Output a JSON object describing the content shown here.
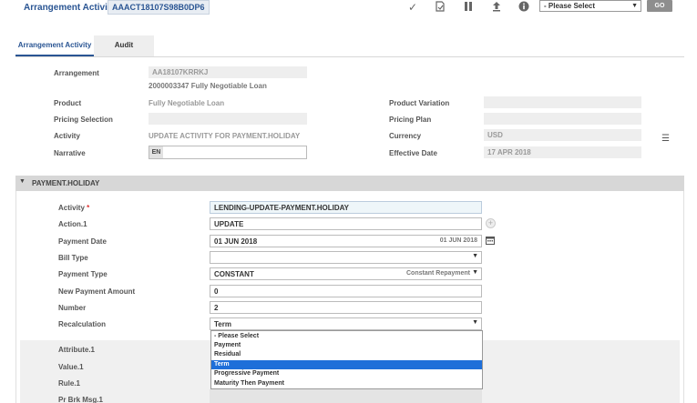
{
  "header": {
    "title": "Arrangement Activity",
    "arrangement_id": "AAACT18107S98B0DP6",
    "select_value": "- Please Select",
    "go_label": "GO"
  },
  "tabs": [
    {
      "label": "Arrangement Activity",
      "active": true
    },
    {
      "label": "Audit",
      "active": false
    }
  ],
  "top_form": {
    "arrangement_label": "Arrangement",
    "arrangement_value": "AA18107KRRKJ",
    "arrangement_sub": "2000003347 Fully Negotiable Loan",
    "product_label": "Product",
    "product_value": "Fully Negotiable Loan",
    "product_variation_label": "Product Variation",
    "pricing_selection_label": "Pricing Selection",
    "pricing_plan_label": "Pricing Plan",
    "activity_label": "Activity",
    "activity_value": "UPDATE ACTIVITY FOR PAYMENT.HOLIDAY",
    "currency_label": "Currency",
    "currency_value": "USD",
    "narrative_label": "Narrative",
    "narrative_lang": "EN",
    "effective_date_label": "Effective Date",
    "effective_date_value": "17 APR 2018"
  },
  "section": {
    "title": "PAYMENT.HOLIDAY",
    "activity_label": "Activity",
    "activity_required": "*",
    "activity_value": "LENDING-UPDATE-PAYMENT.HOLIDAY",
    "action_label": "Action.1",
    "action_value": "UPDATE",
    "payment_date_label": "Payment Date",
    "payment_date_value": "01 JUN 2018",
    "payment_date_right": "01 JUN 2018",
    "bill_type_label": "Bill Type",
    "payment_type_label": "Payment Type",
    "payment_type_value": "CONSTANT",
    "payment_type_right": "Constant Repayment",
    "new_payment_amount_label": "New Payment Amount",
    "new_payment_amount_value": "0",
    "number_label": "Number",
    "number_value": "2",
    "recalculation_label": "Recalculation",
    "recalculation_value": "Term",
    "recalculation_options": [
      "- Please Select",
      "Payment",
      "Residual",
      "Term",
      "Progressive Payment",
      "Maturity Then Payment"
    ],
    "recalculation_selected_index": 3,
    "attribute_label": "Attribute.1",
    "value_label": "Value.1",
    "rule_label": "Rule.1",
    "pr_brk_msg_label": "Pr Brk Msg.1"
  }
}
